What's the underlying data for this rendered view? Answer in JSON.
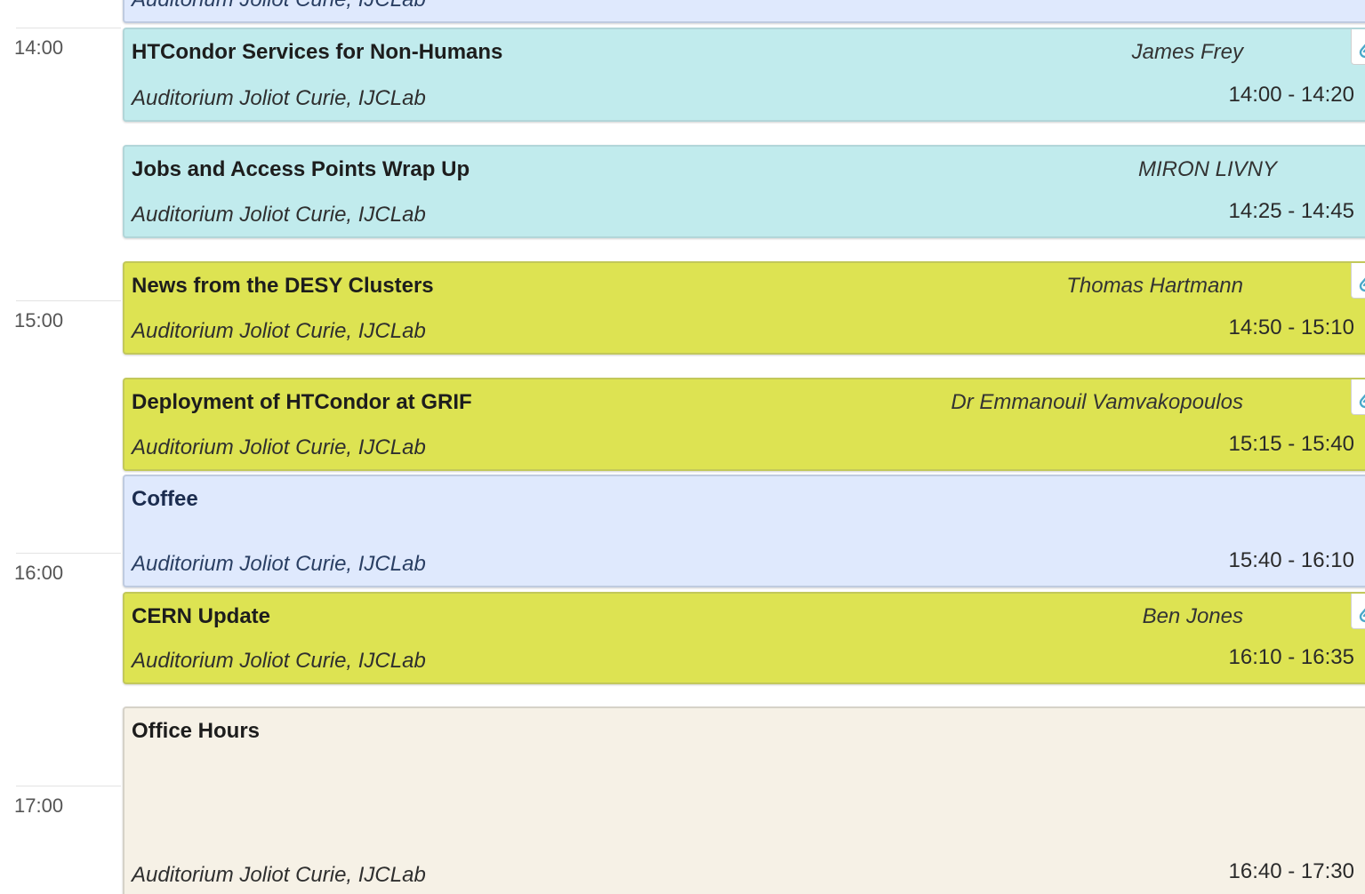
{
  "hours": [
    "14:00",
    "15:00",
    "16:00",
    "17:00"
  ],
  "entries": [
    {
      "title": "",
      "location": "Auditorium Joliot Curie, IJCLab",
      "time": ""
    },
    {
      "title": "HTCondor Services for Non-Humans",
      "speaker": "James Frey",
      "location": "Auditorium Joliot Curie, IJCLab",
      "time": "14:00 - 14:20",
      "attachment_icon": "paperclip-icon"
    },
    {
      "title": "Jobs and Access Points Wrap Up",
      "speaker": "MIRON LIVNY",
      "location": "Auditorium Joliot Curie, IJCLab",
      "time": "14:25 - 14:45"
    },
    {
      "title": "News from the DESY Clusters",
      "speaker": "Thomas Hartmann",
      "location": "Auditorium Joliot Curie, IJCLab",
      "time": "14:50 - 15:10",
      "attachment_icon": "paperclip-icon"
    },
    {
      "title": "Deployment of HTCondor at GRIF",
      "speaker": "Dr Emmanouil Vamvakopoulos",
      "location": "Auditorium Joliot Curie, IJCLab",
      "time": "15:15 - 15:40",
      "attachment_icon": "paperclip-icon"
    },
    {
      "title": "Coffee",
      "location": "Auditorium Joliot Curie, IJCLab",
      "time": "15:40 - 16:10"
    },
    {
      "title": "CERN Update",
      "speaker": "Ben Jones",
      "location": "Auditorium Joliot Curie, IJCLab",
      "time": "16:10 - 16:35",
      "attachment_icon": "paperclip-icon"
    },
    {
      "title": "Office Hours",
      "location": "Auditorium Joliot Curie, IJCLab",
      "time": "16:40 - 17:30"
    }
  ],
  "colors": {
    "contribution_blue": "#c1ebed",
    "contribution_yellow": "#dde352",
    "break_blue": "#dfe9fd",
    "session_beige": "#f6f1e6",
    "attachment_icon": "#4aa8c9"
  }
}
